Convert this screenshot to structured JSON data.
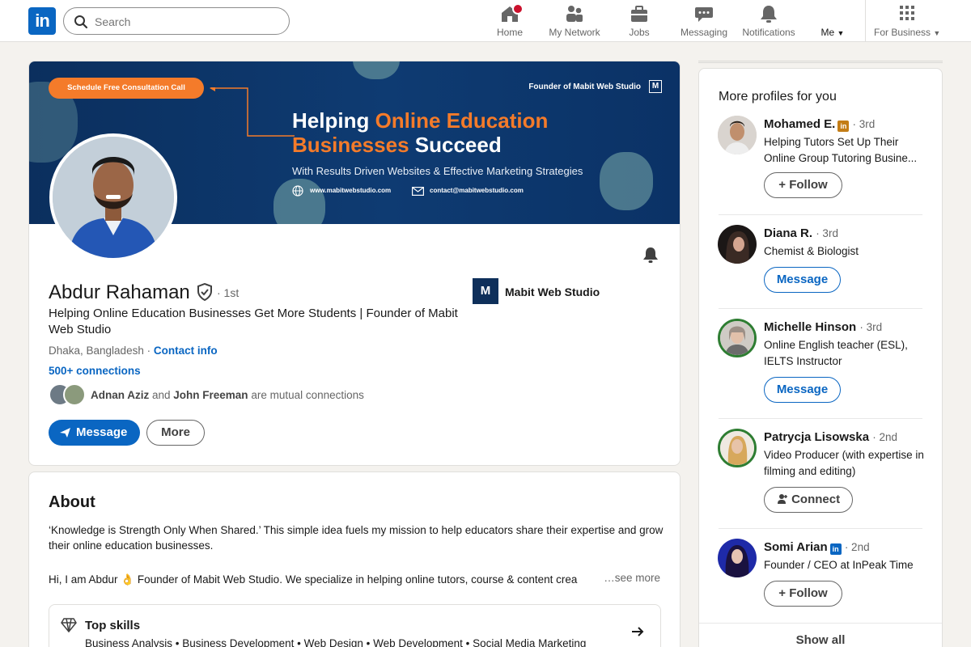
{
  "nav": {
    "logo": "in",
    "search_placeholder": "Search",
    "items": [
      {
        "label": "Home",
        "icon": "home-icon"
      },
      {
        "label": "My Network",
        "icon": "network-icon"
      },
      {
        "label": "Jobs",
        "icon": "briefcase-icon"
      },
      {
        "label": "Messaging",
        "icon": "messaging-icon"
      },
      {
        "label": "Notifications",
        "icon": "bell-icon"
      },
      {
        "label": "Me",
        "icon": "caret-down-icon"
      },
      {
        "label": "For Business",
        "icon": "grid-icon"
      }
    ]
  },
  "banner": {
    "cta": "Schedule Free Consultation Call",
    "founder": "Founder of Mabit Web Studio",
    "logo_letter": "M",
    "headline_a": "Helping ",
    "headline_b": "Online Education",
    "headline_c": "Businesses",
    "headline_d": " Succeed",
    "tagline": "With Results Driven Websites & Effective Marketing Strategies",
    "website": "www.mabitwebstudio.com",
    "email": "contact@mabitwebstudio.com",
    "accent_color": "#f47b2a"
  },
  "profile": {
    "name": "Abdur Rahaman",
    "degree": "· 1st",
    "headline": "Helping Online Education Businesses Get More Students | Founder of Mabit Web Studio",
    "location": "Dhaka, Bangladesh",
    "separator": " · ",
    "contact_info": "Contact info",
    "connections": "500+ connections",
    "mutual_a": "Adnan Aziz",
    "mutual_and": " and ",
    "mutual_b": "John Freeman",
    "mutual_suffix": " are mutual connections",
    "company_logo": "M",
    "company": "Mabit Web Studio",
    "message_btn": "Message",
    "more_btn": "More"
  },
  "about": {
    "title": "About",
    "para1": "‘Knowledge is Strength Only When Shared.’ This simple idea fuels my mission to help educators share their expertise and grow their online education businesses.",
    "para2": "Hi, I am Abdur 👌 Founder of Mabit Web Studio. We specialize in helping online tutors, course & content crea",
    "see_more": "…see more",
    "skills_title": "Top skills",
    "skills": "Business Analysis • Business Development • Web Design • Web Development • Social Media Marketing"
  },
  "rail": {
    "title": "More profiles for you",
    "profiles": [
      {
        "name": "Mohamed E.",
        "degree": "· 3rd",
        "badge": "in",
        "title": "Helping Tutors Set Up Their Online Group Tutoring Busine...",
        "button": "Follow"
      },
      {
        "name": "Diana R.",
        "degree": "· 3rd",
        "title": "Chemist & Biologist",
        "button": "Message"
      },
      {
        "name": "Michelle Hinson",
        "degree": "· 3rd",
        "title": "Online English teacher (ESL), IELTS Instructor",
        "button": "Message"
      },
      {
        "name": "Patrycja Lisowska",
        "degree": "· 2nd",
        "title": "Video Producer (with expertise in filming and editing)",
        "button": "Connect"
      },
      {
        "name": "Somi Arian",
        "degree": "· 2nd",
        "badge": "in",
        "title": "Founder / CEO at InPeak Time",
        "button": "Follow"
      }
    ],
    "show_all": "Show all"
  },
  "colors": {
    "brand": "#0a66c2",
    "badge_gold": "#c37d16",
    "notification": "#cb112d"
  }
}
